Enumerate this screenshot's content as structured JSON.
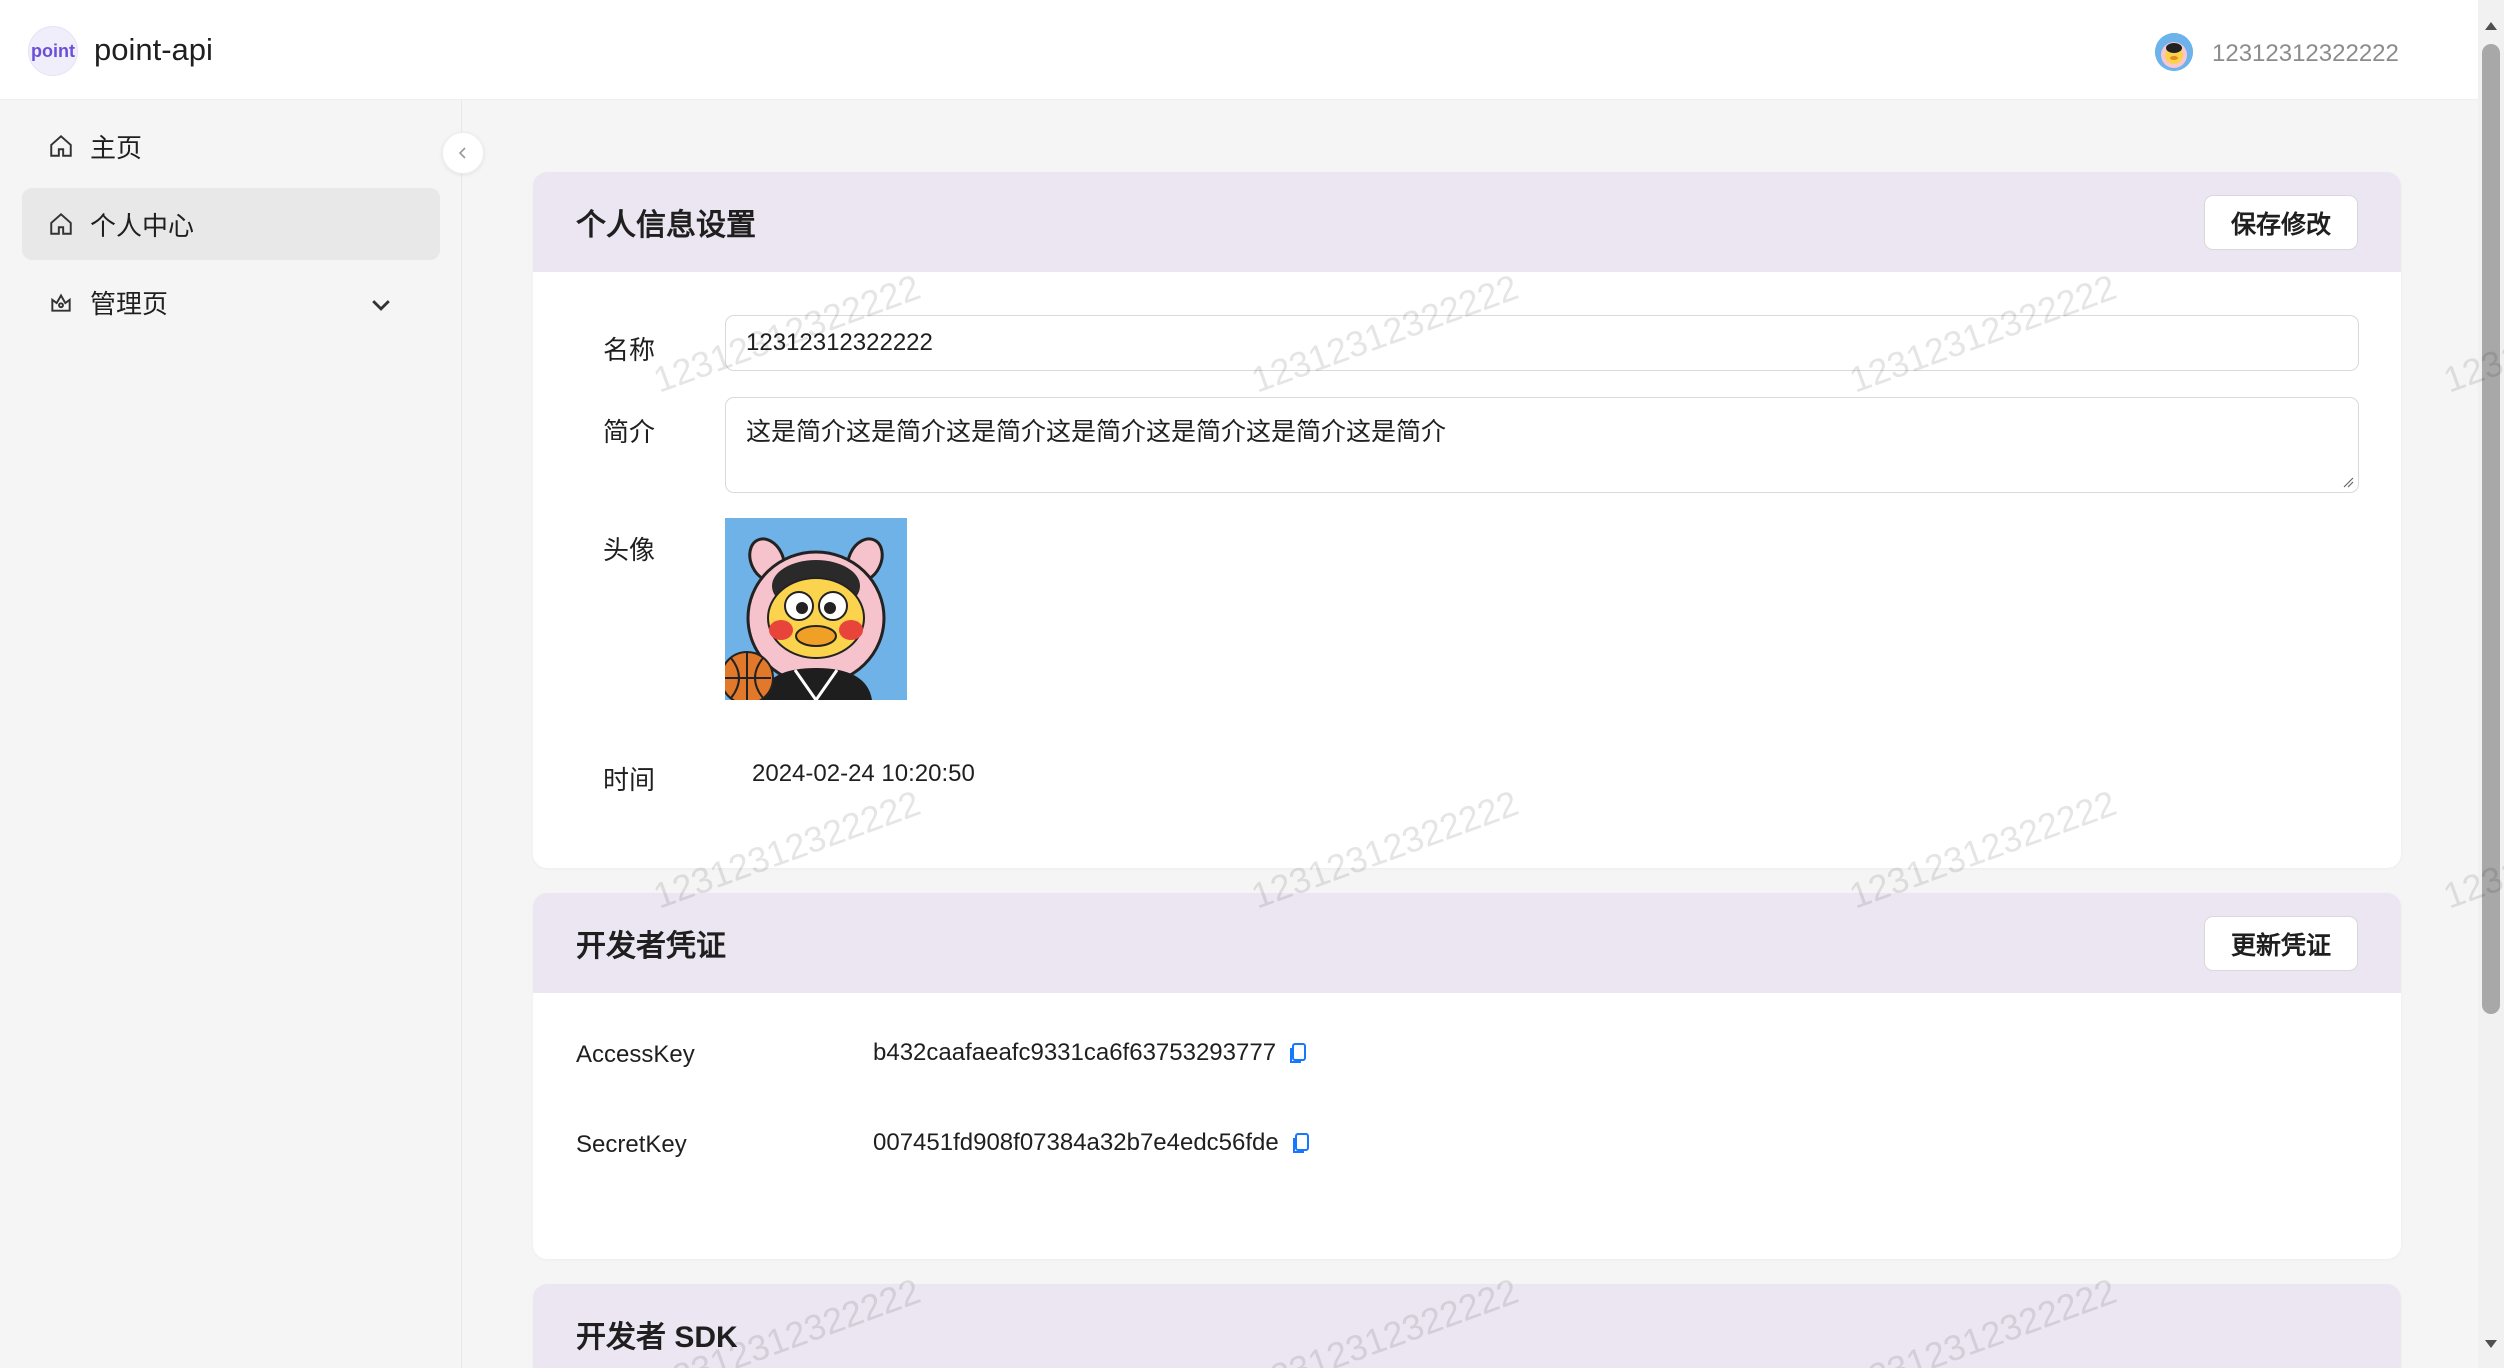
{
  "header": {
    "logo_text": "point",
    "app_title": "point-api",
    "user_name": "12312312322222"
  },
  "sidebar": {
    "items": [
      {
        "label": "主页"
      },
      {
        "label": "个人中心"
      },
      {
        "label": "管理页"
      }
    ]
  },
  "profile": {
    "title": "个人信息设置",
    "save_label": "保存修改",
    "name_label": "名称",
    "name_value": "12312312322222",
    "bio_label": "简介",
    "bio_value": "这是简介这是简介这是简介这是简介这是简介这是简介这是简介",
    "avatar_label": "头像",
    "time_label": "时间",
    "time_value": "2024-02-24 10:20:50"
  },
  "credentials": {
    "title": "开发者凭证",
    "update_label": "更新凭证",
    "access_key_label": "AccessKey",
    "access_key_value": "b432caafaeafc9331ca6f63753293777",
    "secret_key_label": "SecretKey",
    "secret_key_value": "007451fd908f07384a32b7e4edc56fde"
  },
  "sdk": {
    "title": "开发者 SDK"
  },
  "watermark": {
    "text": "12312312322222"
  },
  "colors": {
    "card_header_bg": "#ebe6f1",
    "copy_icon": "#1677ff",
    "logo_accent": "#6b4fd8"
  }
}
